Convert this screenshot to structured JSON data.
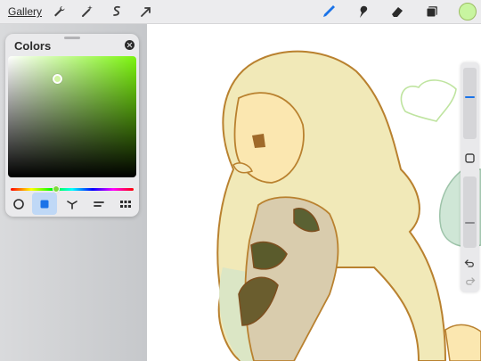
{
  "toolbar": {
    "gallery_label": "Gallery",
    "left_icons": [
      "wrench-icon",
      "magic-wand-icon",
      "selection-icon",
      "transform-icon"
    ],
    "right_icons": [
      "brush-icon",
      "smudge-icon",
      "eraser-icon",
      "layers-icon"
    ],
    "current_color": "#c8f5a0",
    "accent_color": "#1a73e8"
  },
  "colors_panel": {
    "title": "Colors",
    "active_mode": "disc-and-value",
    "modes": [
      "disc-mode",
      "classic-mode",
      "harmony-mode",
      "value-mode",
      "palettes-mode"
    ],
    "hue_color": "#7cf50e"
  },
  "sidebar": {
    "tools": [
      "brush-size-slider",
      "modify-button",
      "opacity-slider",
      "undo-button",
      "redo-button"
    ]
  }
}
